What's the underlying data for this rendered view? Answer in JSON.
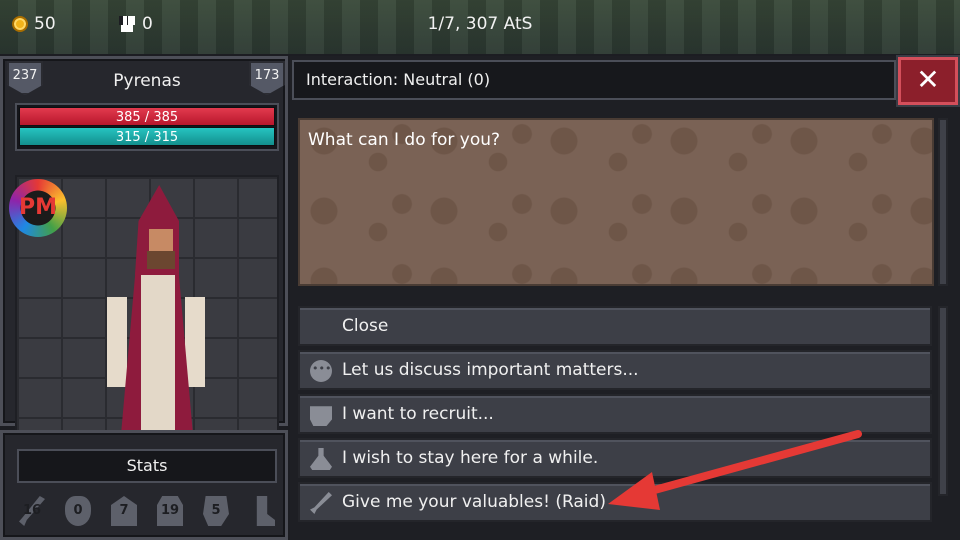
{
  "resources": {
    "gold": "50",
    "troops": "0"
  },
  "date": "1/7, 307 AtS",
  "character": {
    "name": "Pyrenas",
    "level_left": "237",
    "level_right": "173",
    "hp": "385 / 385",
    "mp": "315 / 315",
    "badge": "PM"
  },
  "stats": {
    "label": "Stats",
    "values": {
      "attack": "16",
      "defense": "0",
      "head": "7",
      "chest": "19",
      "hands": "5",
      "feet": ""
    }
  },
  "interaction": {
    "title": "Interaction: Neutral (0)",
    "close_symbol": "✕"
  },
  "dialog": {
    "text": "What can I do for you?"
  },
  "options": [
    {
      "label": "Close",
      "icon": "none"
    },
    {
      "label": "Let us discuss important matters...",
      "icon": "chat-bubble-icon"
    },
    {
      "label": "I want to recruit...",
      "icon": "fist-icon"
    },
    {
      "label": "I wish to stay here for a while.",
      "icon": "flask-icon"
    },
    {
      "label": "Give me your valuables! (Raid)",
      "icon": "sword-icon"
    }
  ],
  "colors": {
    "hp": "#c8223a",
    "mp": "#1aa8a5",
    "close": "#8c1f2b",
    "annotation_arrow": "#e53935"
  }
}
